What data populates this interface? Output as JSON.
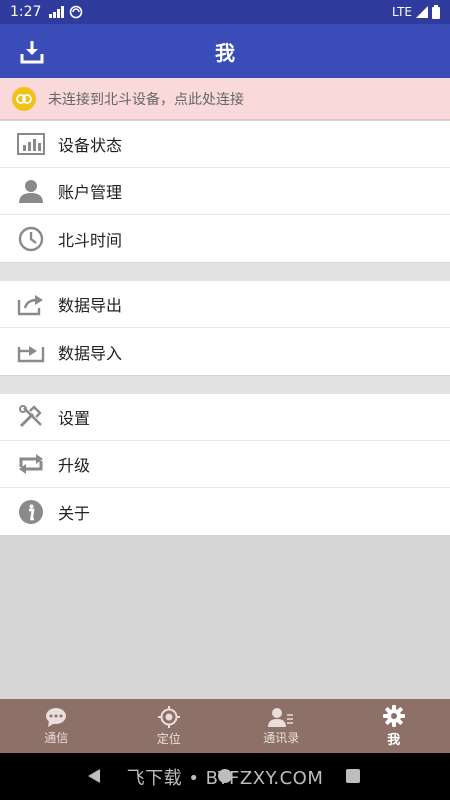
{
  "status_bar": {
    "time": "1:27",
    "network": "LTE"
  },
  "app_bar": {
    "title": "我"
  },
  "banner": {
    "text": "未连接到北斗设备，点此处连接"
  },
  "menu_groups": [
    [
      {
        "label": "设备状态",
        "icon": "bar-chart-icon"
      },
      {
        "label": "账户管理",
        "icon": "person-icon"
      },
      {
        "label": "北斗时间",
        "icon": "clock-icon"
      }
    ],
    [
      {
        "label": "数据导出",
        "icon": "share-export-icon"
      },
      {
        "label": "数据导入",
        "icon": "import-icon"
      }
    ],
    [
      {
        "label": "设置",
        "icon": "tools-icon"
      },
      {
        "label": "升级",
        "icon": "repeat-icon"
      },
      {
        "label": "关于",
        "icon": "info-icon"
      }
    ]
  ],
  "tabs": [
    {
      "label": "通信",
      "icon": "chat-icon",
      "active": false
    },
    {
      "label": "定位",
      "icon": "location-target-icon",
      "active": false
    },
    {
      "label": "通讯录",
      "icon": "contacts-icon",
      "active": false
    },
    {
      "label": "我",
      "icon": "gear-icon",
      "active": true
    }
  ],
  "watermark": "飞下载 • BYFZXY.COM",
  "colors": {
    "status_bar": "#2f3c9e",
    "app_bar": "#3a4cb8",
    "banner_bg": "#f9d9d9",
    "tab_bar": "#8d7168",
    "icon_gray": "#8a8a8a",
    "link_yellow": "#f2c316"
  }
}
